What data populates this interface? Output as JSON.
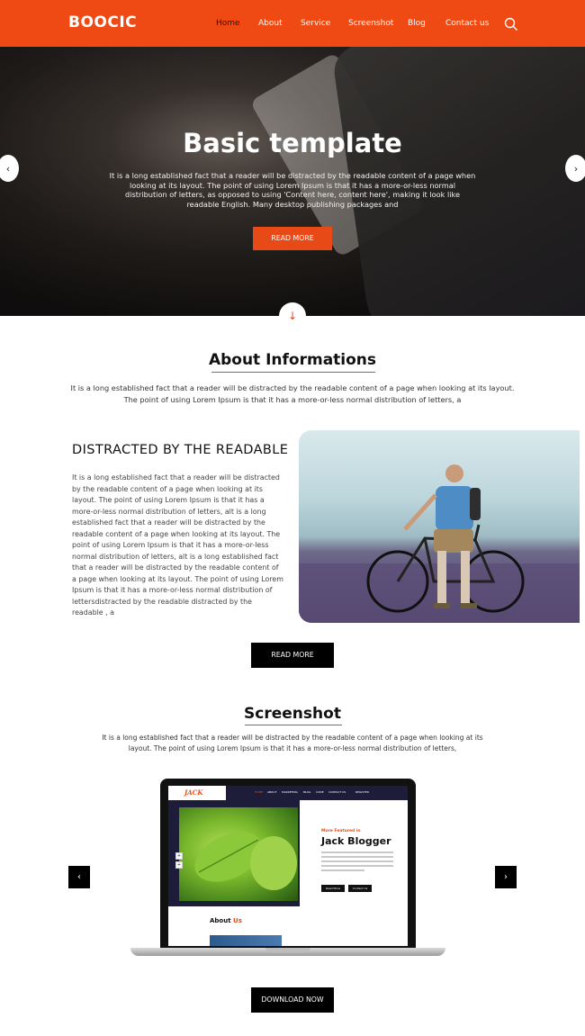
{
  "header": {
    "logo": "BOOCIC",
    "nav": [
      {
        "label": "Home",
        "active": true
      },
      {
        "label": "About",
        "active": false
      },
      {
        "label": "Service",
        "active": false
      },
      {
        "label": "Screenshot",
        "active": false
      },
      {
        "label": "Blog",
        "active": false
      },
      {
        "label": "Contact us",
        "active": false
      }
    ],
    "search_icon": "search-icon"
  },
  "hero": {
    "title": "Basic template",
    "text": "It is a long established fact that a reader will be distracted by the readable content of a page when looking at its layout. The point of using Lorem Ipsum is that it has a more-or-less normal distribution of letters, as opposed to using 'Content here, content here', making it look like readable English. Many desktop publishing packages and",
    "button": "READ MORE",
    "prev_icon": "chevron-left-icon",
    "next_icon": "chevron-right-icon",
    "scroll_icon": "arrow-down-icon"
  },
  "about": {
    "title": "About Informations",
    "text": "It is a long established fact that a reader will be distracted by the readable content of a page when looking at its layout. The point of using Lorem Ipsum is that it has a more-or-less normal distribution of letters, a",
    "feature_title": "DISTRACTED BY THE READABLE",
    "feature_text": "It is a long established fact that a reader will be distracted by the readable content of a page when looking at its layout. The point of using Lorem Ipsum is that it has a more-or-less normal distribution of letters, alt is a long established fact that a reader will be distracted by the readable content of a page when looking at its layout. The point of using Lorem Ipsum is that it has a more-or-less normal distribution of letters, alt is a long established fact that a reader will be distracted by the readable content of a page when looking at its layout. The point of using Lorem Ipsum is that it has a more-or-less normal distribution of lettersdistracted by the readable distracted by the readable , a",
    "button": "READ MORE"
  },
  "screenshot": {
    "title": "Screenshot",
    "text": "It is a long established fact that a reader will be distracted by the readable content of a page when looking at its layout. The point of using Lorem Ipsum is that it has a more-or-less normal distribution of letters,",
    "mock": {
      "logo": "JACK",
      "nav": [
        "HOME",
        "ABOUT",
        "MARKETING",
        "BLOG",
        "CODE",
        "CONTACT US",
        "REGISTER"
      ],
      "kicker": "More Featured in",
      "headline": "Jack Blogger",
      "btn1": "Read More",
      "btn2": "Contact Us",
      "about_prefix": "About",
      "about_suffix": "Us"
    },
    "button": "DOWNLOAD NOW"
  },
  "colors": {
    "accent": "#f04a14",
    "dark": "#000000"
  }
}
